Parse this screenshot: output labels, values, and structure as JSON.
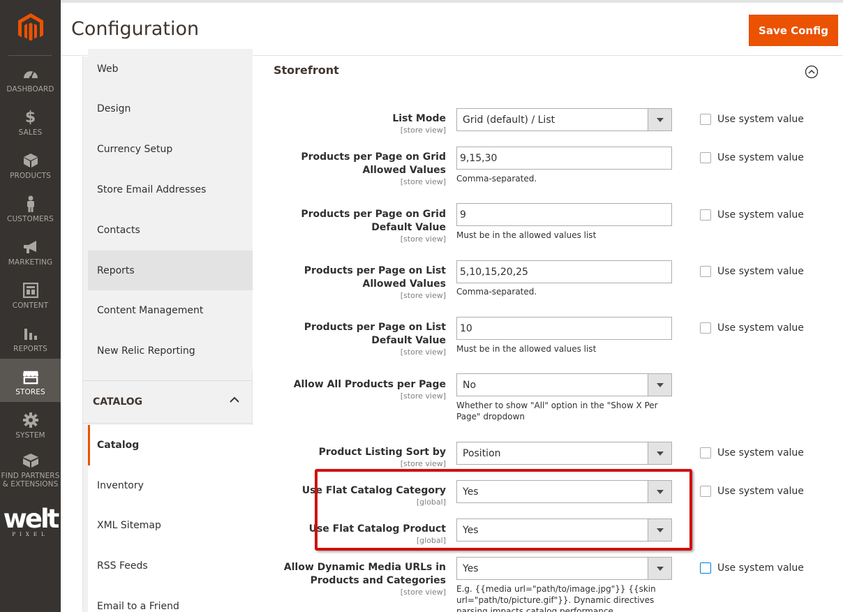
{
  "nav": {
    "items": [
      {
        "label": "DASHBOARD",
        "icon": "dashboard-icon"
      },
      {
        "label": "SALES",
        "icon": "dollar-icon"
      },
      {
        "label": "PRODUCTS",
        "icon": "box-icon"
      },
      {
        "label": "CUSTOMERS",
        "icon": "person-icon"
      },
      {
        "label": "MARKETING",
        "icon": "megaphone-icon"
      },
      {
        "label": "CONTENT",
        "icon": "layout-icon"
      },
      {
        "label": "REPORTS",
        "icon": "bar-chart-icon"
      },
      {
        "label": "STORES",
        "icon": "store-icon"
      },
      {
        "label": "SYSTEM",
        "icon": "gear-icon"
      },
      {
        "label": "FIND PARTNERS & EXTENSIONS",
        "icon": "extensions-icon"
      }
    ],
    "brand": {
      "main": "welt",
      "sub": "PIXEL"
    }
  },
  "header": {
    "title": "Configuration",
    "save_label": "Save Config"
  },
  "tabs": {
    "general_items": [
      "Web",
      "Design",
      "Currency Setup",
      "Store Email Addresses",
      "Contacts",
      "Reports",
      "Content Management",
      "New Relic Reporting"
    ],
    "catalog_heading": "CATALOG",
    "catalog_items": [
      "Catalog",
      "Inventory",
      "XML Sitemap",
      "RSS Feeds",
      "Email to a Friend"
    ]
  },
  "section": {
    "title": "Storefront"
  },
  "rows": {
    "list_mode": {
      "label": "List Mode",
      "scope": "[store view]",
      "value": "Grid (default) / List",
      "sys": "Use system value"
    },
    "grid_allowed": {
      "label": "Products per Page on Grid Allowed Values",
      "scope": "[store view]",
      "value": "9,15,30",
      "note": "Comma-separated.",
      "sys": "Use system value"
    },
    "grid_default": {
      "label": "Products per Page on Grid Default Value",
      "scope": "[store view]",
      "value": "9",
      "note": "Must be in the allowed values list",
      "sys": "Use system value"
    },
    "list_allowed": {
      "label": "Products per Page on List Allowed Values",
      "scope": "[store view]",
      "value": "5,10,15,20,25",
      "note": "Comma-separated.",
      "sys": "Use system value"
    },
    "list_default": {
      "label": "Products per Page on List Default Value",
      "scope": "[store view]",
      "value": "10",
      "note": "Must be in the allowed values list",
      "sys": "Use system value"
    },
    "allow_all": {
      "label": "Allow All Products per Page",
      "scope": "[store view]",
      "value": "No",
      "note": "Whether to show \"All\" option in the \"Show X Per Page\" dropdown"
    },
    "sort_by": {
      "label": "Product Listing Sort by",
      "scope": "[store view]",
      "value": "Position",
      "sys": "Use system value"
    },
    "flat_category": {
      "label": "Use Flat Catalog Category",
      "scope": "[global]",
      "value": "Yes",
      "sys": "Use system value"
    },
    "flat_product": {
      "label": "Use Flat Catalog Product",
      "scope": "[global]",
      "value": "Yes"
    },
    "dynamic_media": {
      "label": "Allow Dynamic Media URLs in Products and Categories",
      "scope": "[store view]",
      "value": "Yes",
      "note": "E.g. {{media url=\"path/to/image.jpg\"}} {{skin url=\"path/to/picture.gif\"}}. Dynamic directives parsing impacts catalog performance.",
      "sys": "Use system value"
    }
  },
  "colors": {
    "accent": "#eb5202",
    "nav_bg": "#373330",
    "highlight": "#d10f0f"
  }
}
